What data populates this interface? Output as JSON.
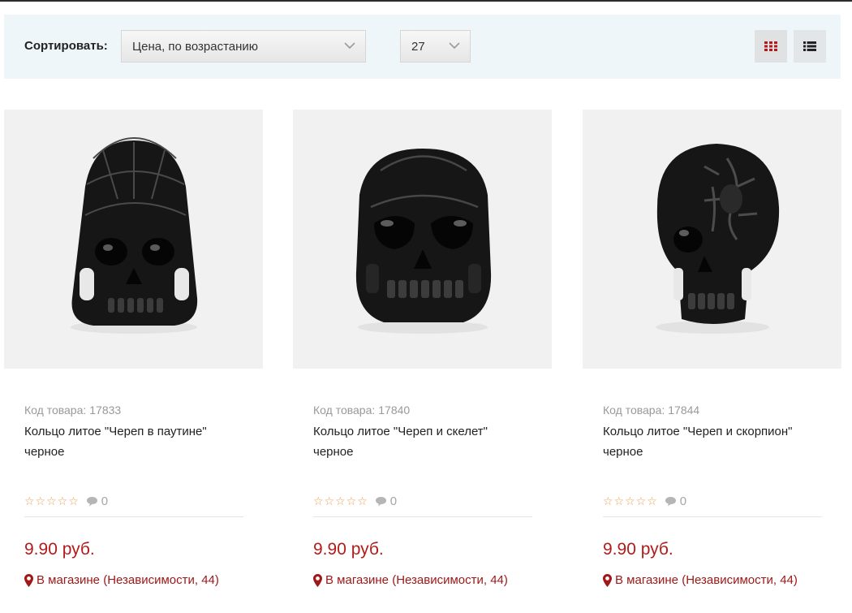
{
  "toolbar": {
    "sort_label": "Сортировать:",
    "sort_value": "Цена, по возрастанию",
    "per_page_value": "27",
    "grid_view_icon": "grid-icon",
    "list_view_icon": "list-icon",
    "active_view": "grid"
  },
  "colors": {
    "accent": "#b31b1b",
    "star": "#e8a050",
    "toolbar_bg": "#eef6fa"
  },
  "products": [
    {
      "code_label": "Код товара:",
      "code": "17833",
      "title": "Кольцо литое \"Череп в паутине\" черное",
      "rating": 0,
      "stars": "☆☆☆☆☆",
      "comments": "0",
      "price": "9.90 руб.",
      "store": "В магазине (Независимости, 44)"
    },
    {
      "code_label": "Код товара:",
      "code": "17840",
      "title": "Кольцо литое \"Череп и скелет\" черное",
      "rating": 0,
      "stars": "☆☆☆☆☆",
      "comments": "0",
      "price": "9.90 руб.",
      "store": "В магазине (Независимости, 44)"
    },
    {
      "code_label": "Код товара:",
      "code": "17844",
      "title": "Кольцо литое \"Череп и скорпион\" черное",
      "rating": 0,
      "stars": "☆☆☆☆☆",
      "comments": "0",
      "price": "9.90 руб.",
      "store": "В магазине (Независимости, 44)"
    }
  ]
}
